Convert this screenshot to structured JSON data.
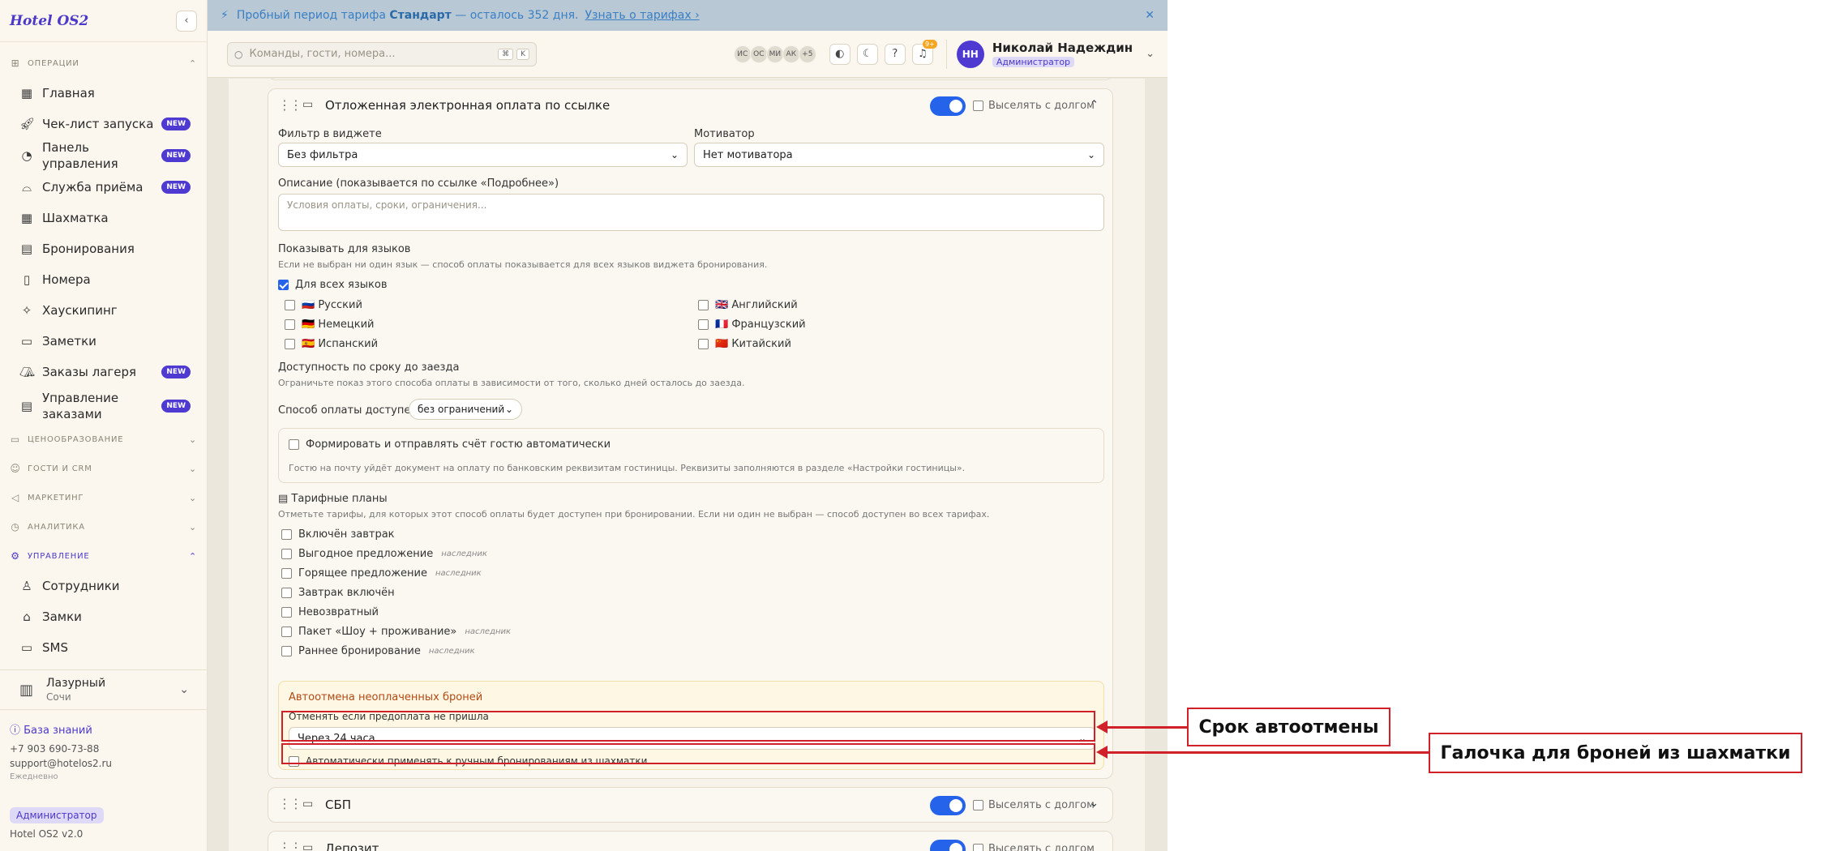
{
  "app": {
    "logo": "Hotel OS2"
  },
  "sidebar": {
    "sections": [
      {
        "label": "ОПЕРАЦИИ",
        "expanded": true,
        "items": [
          {
            "label": "Главная",
            "icon": "dashboard-icon"
          },
          {
            "label": "Чек-лист запуска",
            "icon": "rocket-icon",
            "badge": "NEW"
          },
          {
            "label": "Панель управления",
            "icon": "gauge-icon",
            "badge": "NEW"
          },
          {
            "label": "Служба приёма",
            "icon": "bell-icon",
            "badge": "NEW"
          },
          {
            "label": "Шахматка",
            "icon": "grid-icon"
          },
          {
            "label": "Бронирования",
            "icon": "clipboard-icon"
          },
          {
            "label": "Номера",
            "icon": "door-icon"
          },
          {
            "label": "Хаускипинг",
            "icon": "sparkle-icon"
          },
          {
            "label": "Заметки",
            "icon": "note-icon"
          },
          {
            "label": "Заказы лагеря",
            "icon": "tent-icon",
            "badge": "NEW"
          },
          {
            "label": "Управление заказами",
            "icon": "receipt-icon",
            "badge": "NEW"
          }
        ]
      },
      {
        "label": "ЦЕНООБРАЗОВАНИЕ",
        "expanded": false
      },
      {
        "label": "ГОСТИ И CRM",
        "expanded": false
      },
      {
        "label": "МАРКЕТИНГ",
        "expanded": false
      },
      {
        "label": "АНАЛИТИКА",
        "expanded": false
      },
      {
        "label": "УПРАВЛЕНИЕ",
        "expanded": true,
        "active": true,
        "items": [
          {
            "label": "Сотрудники",
            "icon": "user-icon"
          },
          {
            "label": "Замки",
            "icon": "lock-icon"
          },
          {
            "label": "SMS",
            "icon": "message-icon"
          }
        ]
      }
    ],
    "hotel": {
      "name": "Лазурный",
      "city": "Сочи"
    },
    "footer": {
      "knowledge_base": "База знаний",
      "phone": "+7 903 690-73-88",
      "email": "support@hotelos2.ru",
      "schedule": "Ежедневно",
      "role": "Администратор",
      "version": "Hotel OS2 v2.0"
    }
  },
  "trial": {
    "text_before": "Пробный период тарифа",
    "plan": "Стандарт",
    "text_after": "— осталось 352 дня.",
    "link": "Узнать о тарифах ›"
  },
  "topbar": {
    "search_placeholder": "Команды, гости, номера...",
    "shortcut_1": "⌘",
    "shortcut_2": "K",
    "online_users": [
      "ИС",
      "ОС",
      "МИ",
      "АК"
    ],
    "online_more": "+5",
    "notifications_count": "9+",
    "user": {
      "initials": "НН",
      "name": "Николай Надеждин",
      "role": "Администратор"
    }
  },
  "payment_card": {
    "title": "Отложенная электронная оплата по ссылке",
    "enabled": true,
    "evict_with_debt_label": "Выселять с долгом",
    "filter_label": "Фильтр в виджете",
    "filter_value": "Без фильтра",
    "motivator_label": "Мотиватор",
    "motivator_value": "Нет мотиватора",
    "description_label": "Описание (показывается по ссылке «Подробнее»)",
    "description_placeholder": "Условия оплаты, сроки, ограничения...",
    "languages_label": "Показывать для языков",
    "languages_hint": "Если не выбран ни один язык — способ оплаты показывается для всех языков виджета бронирования.",
    "all_languages_label": "Для всех языков",
    "languages": [
      {
        "flag": "🇷🇺",
        "label": "Русский"
      },
      {
        "flag": "🇬🇧",
        "label": "Английский"
      },
      {
        "flag": "🇩🇪",
        "label": "Немецкий"
      },
      {
        "flag": "🇫🇷",
        "label": "Французский"
      },
      {
        "flag": "🇪🇸",
        "label": "Испанский"
      },
      {
        "flag": "🇨🇳",
        "label": "Китайский"
      }
    ],
    "availability_label": "Доступность по сроку до заезда",
    "availability_hint": "Ограничьте показ этого способа оплаты в зависимости от того, сколько дней осталось до заезда.",
    "availability_select_label": "Способ оплаты доступен",
    "availability_value": "без ограничений",
    "auto_invoice_label": "Формировать и отправлять счёт гостю автоматически",
    "auto_invoice_hint": "Гостю на почту уйдёт документ на оплату по банковским реквизитам гостиницы. Реквизиты заполняются в разделе «Настройки гостиницы».",
    "tariffs_label": "Тарифные планы",
    "tariffs_hint": "Отметьте тарифы, для которых этот способ оплаты будет доступен при бронировании. Если ни один не выбран — способ доступен во всех тарифах.",
    "inherited_tag": "наследник",
    "tariffs": [
      {
        "label": "Включён завтрак",
        "inherited": false
      },
      {
        "label": "Выгодное предложение",
        "inherited": true
      },
      {
        "label": "Горящее предложение",
        "inherited": true
      },
      {
        "label": "Завтрак включён",
        "inherited": false
      },
      {
        "label": "Невозвратный",
        "inherited": false
      },
      {
        "label": "Пакет «Шоу + проживание»",
        "inherited": true
      },
      {
        "label": "Раннее бронирование",
        "inherited": true
      }
    ],
    "auto_cancel": {
      "title": "Автоотмена неоплаченных броней",
      "subtitle": "Отменять если предоплата не пришла",
      "value": "Через 24 часа",
      "manual_label": "Автоматически применять к ручным бронированиям из шахматки"
    }
  },
  "other_cards": [
    {
      "title": "СБП",
      "enabled": true,
      "evict_with_debt_label": "Выселять с долгом"
    },
    {
      "title": "Депозит",
      "enabled": true,
      "evict_with_debt_label": "Выселять с долгом"
    }
  ],
  "annotations": {
    "callout_1": "Срок автоотмены",
    "callout_2": "Галочка для броней из шахматки",
    "color": "#d0202a"
  },
  "colors": {
    "accent": "#4f3ad1",
    "toggle": "#2563eb",
    "warning_title": "#b34a16"
  }
}
